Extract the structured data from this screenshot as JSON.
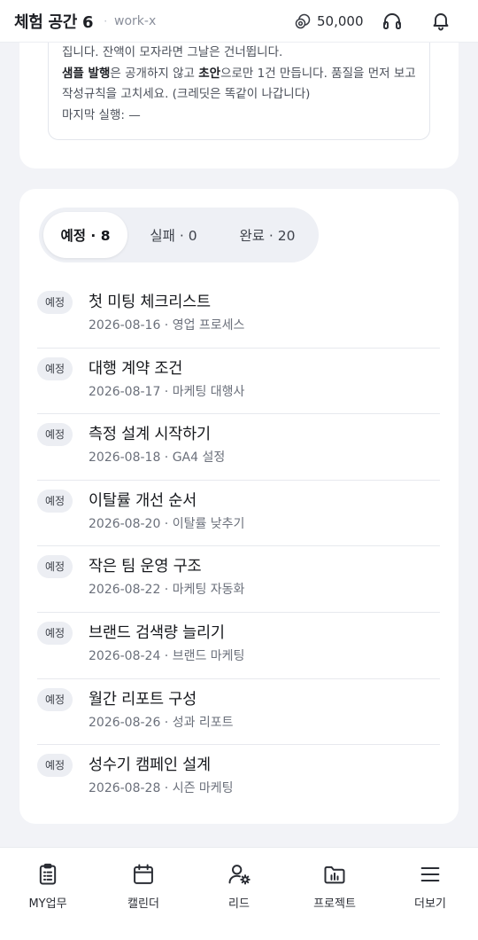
{
  "header": {
    "title": "체험 공간 6",
    "separator": "·",
    "workspace_id": "work-x",
    "credits": "50,000",
    "icons": [
      "coin-icon",
      "headset-icon",
      "bell-icon"
    ]
  },
  "notice": {
    "line1": "집니다. 잔액이 모자라면 그날은 건너뜁니다.",
    "line2_bold1": "샘플 발행",
    "line2_text1": "은 공개하지 않고 ",
    "line2_bold2": "초안",
    "line2_text2": "으로만 1건 만듭니다. 품질을 먼저 보고",
    "line3": "작성규칙을 고치세요. (크레딧은 똑같이 나갑니다)",
    "line4": "마지막 실행: —"
  },
  "tabs": [
    {
      "label": "예정 · 8",
      "active": true
    },
    {
      "label": "실패 · 0",
      "active": false
    },
    {
      "label": "완료 · 20",
      "active": false
    }
  ],
  "items": [
    {
      "badge": "예정",
      "title": "첫 미팅 체크리스트",
      "meta": "2026-08-16 · 영업 프로세스"
    },
    {
      "badge": "예정",
      "title": "대행 계약 조건",
      "meta": "2026-08-17 · 마케팅 대행사"
    },
    {
      "badge": "예정",
      "title": "측정 설계 시작하기",
      "meta": "2026-08-18 · GA4 설정"
    },
    {
      "badge": "예정",
      "title": "이탈률 개선 순서",
      "meta": "2026-08-20 · 이탈률 낮추기"
    },
    {
      "badge": "예정",
      "title": "작은 팀 운영 구조",
      "meta": "2026-08-22 · 마케팅 자동화"
    },
    {
      "badge": "예정",
      "title": "브랜드 검색량 늘리기",
      "meta": "2026-08-24 · 브랜드 마케팅"
    },
    {
      "badge": "예정",
      "title": "월간 리포트 구성",
      "meta": "2026-08-26 · 성과 리포트"
    },
    {
      "badge": "예정",
      "title": "성수기 캠페인 설계",
      "meta": "2026-08-28 · 시즌 마케팅"
    }
  ],
  "bottom_nav": [
    {
      "label": "MY업무",
      "icon": "clipboard-icon"
    },
    {
      "label": "캘린더",
      "icon": "calendar-icon"
    },
    {
      "label": "리드",
      "icon": "user-gear-icon"
    },
    {
      "label": "프로젝트",
      "icon": "folder-chart-icon"
    },
    {
      "label": "더보기",
      "icon": "menu-icon"
    }
  ],
  "colors": {
    "background": "#f2f3f7",
    "card": "#ffffff",
    "tab_track": "#eef0f5",
    "badge": "#eceef3"
  }
}
